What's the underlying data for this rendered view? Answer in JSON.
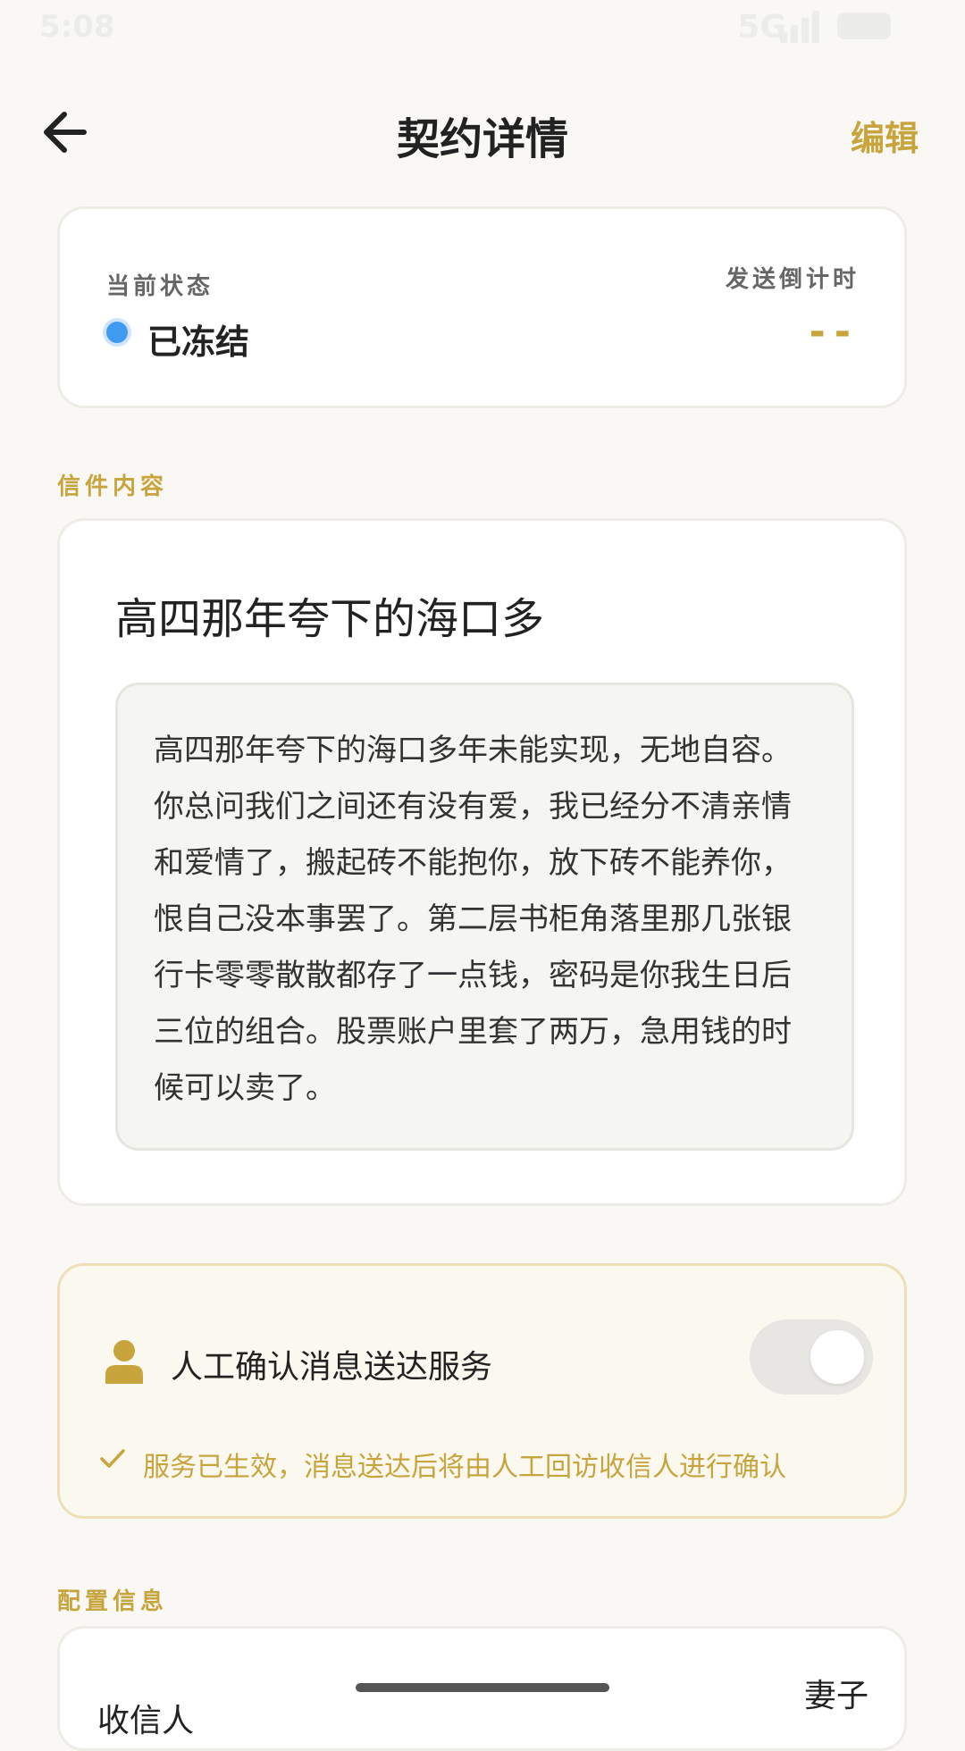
{
  "status_bar": {
    "time": "5:08",
    "network": "5G"
  },
  "header": {
    "title": "契约详情",
    "edit_label": "编辑"
  },
  "status_card": {
    "status_label": "当前状态",
    "status_value": "已冻结",
    "status_color": "#3e9bf0",
    "countdown_label": "发送倒计时",
    "countdown_value": "--"
  },
  "letter": {
    "section_label": "信件内容",
    "title": "高四那年夸下的海口多",
    "body": "高四那年夸下的海口多年未能实现，无地自容。你总问我们之间还有没有爱，我已经分不清亲情和爱情了，搬起砖不能抱你，放下砖不能养你，恨自己没本事罢了。第二层书柜角落里那几张银行卡零零散散都存了一点钱，密码是你我生日后三位的组合。股票账户里套了两万，急用钱的时候可以卖了。"
  },
  "service": {
    "icon": "person-icon",
    "title": "人工确认消息送达服务",
    "enabled": true,
    "note": "服务已生效，消息送达后将由人工回访收信人进行确认",
    "accent": "#c7a43c"
  },
  "config": {
    "section_label": "配置信息",
    "recipient_label": "收信人",
    "recipient_value": "妻子"
  }
}
